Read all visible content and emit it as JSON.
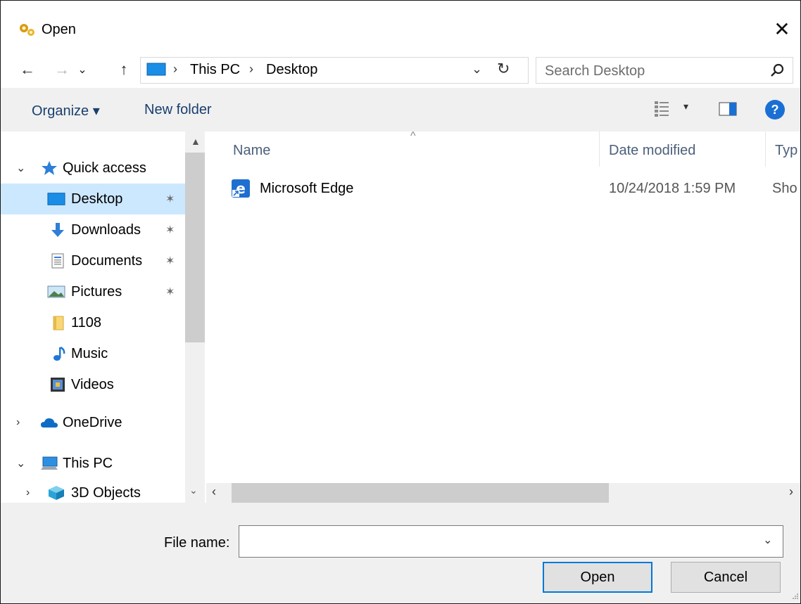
{
  "window": {
    "title": "Open",
    "close_glyph": "✕"
  },
  "nav": {
    "back": "←",
    "forward": "→",
    "recent": "⌄",
    "up": "↑",
    "breadcrumb": [
      "This PC",
      "Desktop"
    ],
    "separator": "›",
    "address_dropdown": "⌄",
    "refresh": "↻",
    "search_placeholder": "Search Desktop"
  },
  "toolbar": {
    "organize": "Organize ▾",
    "new_folder": "New folder",
    "view_dropdown": "▾",
    "help": "?"
  },
  "sidebar": {
    "items": [
      {
        "label": "Quick access",
        "icon": "star-icon",
        "expanded": true
      },
      {
        "label": "Desktop",
        "icon": "desktop-icon",
        "pinned": true,
        "selected": true
      },
      {
        "label": "Downloads",
        "icon": "download-icon",
        "pinned": true
      },
      {
        "label": "Documents",
        "icon": "document-icon",
        "pinned": true
      },
      {
        "label": "Pictures",
        "icon": "pictures-icon",
        "pinned": true
      },
      {
        "label": "1108",
        "icon": "folder-icon"
      },
      {
        "label": "Music",
        "icon": "music-icon"
      },
      {
        "label": "Videos",
        "icon": "video-icon"
      },
      {
        "label": "OneDrive",
        "icon": "cloud-icon",
        "expanded": false
      },
      {
        "label": "This PC",
        "icon": "computer-icon",
        "expanded": true
      },
      {
        "label": "3D Objects",
        "icon": "3d-objects-icon",
        "expanded": false
      }
    ]
  },
  "filelist": {
    "columns": [
      "Name",
      "Date modified",
      "Typ"
    ],
    "sort_indicator": "^",
    "rows": [
      {
        "name": "Microsoft Edge",
        "date": "10/24/2018 1:59 PM",
        "type": "Sho"
      }
    ]
  },
  "footer": {
    "filename_label": "File name:",
    "filename_value": "",
    "open": "Open",
    "cancel": "Cancel"
  },
  "colors": {
    "selection": "#cce8ff",
    "accent": "#0078d7",
    "folder": "#f8d775"
  }
}
